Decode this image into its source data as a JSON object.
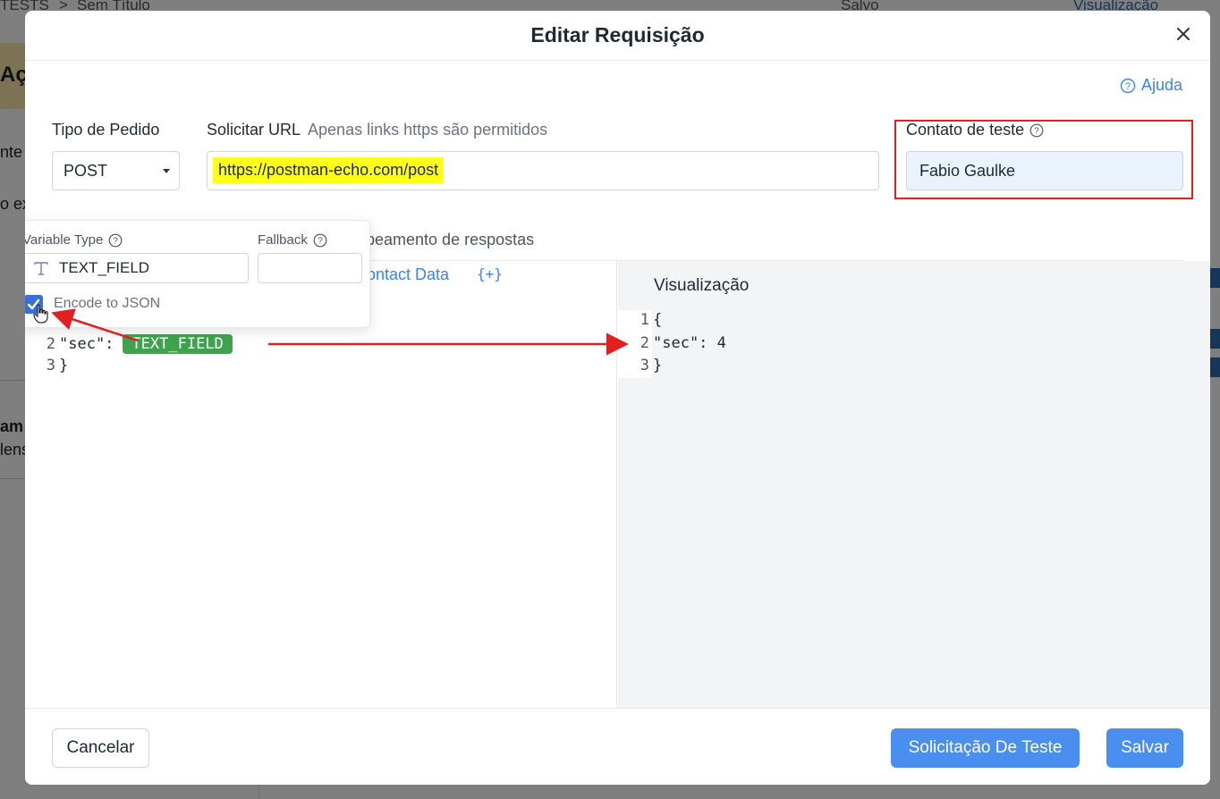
{
  "background": {
    "breadcrumb_root": "TESTS",
    "breadcrumb_sep": ">",
    "breadcrumb_page": "Sem Título",
    "saved_status": "Salvo",
    "view_mode": "Visualização",
    "frag_actions": "Aç",
    "frag_1": "nte",
    "frag_2": "o ex",
    "frag_3": "am",
    "frag_4": "lens"
  },
  "modal": {
    "title": "Editar Requisição",
    "help_label": "Ajuda",
    "request_type": {
      "label": "Tipo de Pedido",
      "value": "POST"
    },
    "request_url": {
      "label": "Solicitar URL",
      "hint": "Apenas links https são permitidos",
      "value": "https://postman-echo.com/post"
    },
    "test_contact": {
      "label": "Contato de teste",
      "value": "Fabio Gaulke"
    },
    "tab_mapping": "peamento de respostas",
    "contact_data_link": "ontact Data",
    "plus_token": "{+}",
    "editor": {
      "lines": [
        {
          "num": "2",
          "text": "\"sec\":",
          "variable": "TEXT_FIELD"
        },
        {
          "num": "3",
          "text": "}"
        }
      ]
    },
    "preview": {
      "title": "Visualização",
      "lines": [
        {
          "num": "1",
          "text": "{"
        },
        {
          "num": "2",
          "text": "\"sec\": 4"
        },
        {
          "num": "3",
          "text": "}"
        }
      ]
    },
    "popover": {
      "variable_type_label": "Variable Type",
      "variable_type_value": "TEXT_FIELD",
      "fallback_label": "Fallback",
      "fallback_value": "",
      "encode_label": "Encode to JSON",
      "encode_checked": true
    },
    "footer": {
      "cancel": "Cancelar",
      "test_request": "Solicitação De Teste",
      "save": "Salvar"
    }
  },
  "colors": {
    "accent": "#4a8ef0",
    "link": "#3b82f6",
    "variable_chip": "#3fa34d",
    "url_highlight": "#ffff1a",
    "annotation": "#e02020"
  }
}
